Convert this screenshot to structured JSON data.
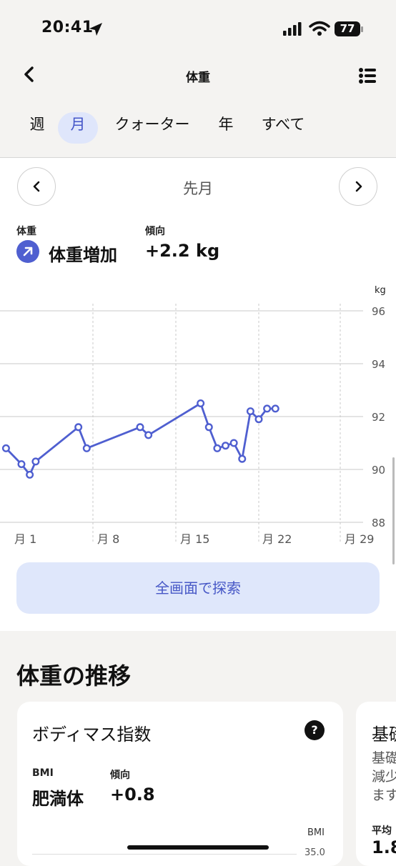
{
  "status_bar": {
    "time": "20:41",
    "battery": "77"
  },
  "header": {
    "title": "体重"
  },
  "period_tabs": [
    {
      "label": "週",
      "active": false
    },
    {
      "label": "月",
      "active": true
    },
    {
      "label": "クォーター",
      "active": false
    },
    {
      "label": "年",
      "active": false
    },
    {
      "label": "すべて",
      "active": false
    }
  ],
  "range": {
    "label": "先月"
  },
  "summary": {
    "weight_label": "体重",
    "weight_value": "体重増加",
    "trend_label": "傾向",
    "trend_value": "+2.2 kg"
  },
  "chart_data": {
    "type": "line",
    "unit": "kg",
    "ylim": [
      88,
      96
    ],
    "y_ticks": [
      "96",
      "94",
      "92",
      "90",
      "88"
    ],
    "x_ticks": [
      "月 1",
      "月 8",
      "月 15",
      "月 22",
      "月 29"
    ],
    "grid": true,
    "color": "#4f5fd0",
    "series": [
      {
        "day": [
          -1.3,
          0,
          0.7,
          1.2,
          4.8,
          5.5,
          10.0,
          10.7,
          15.1,
          15.8,
          16.5,
          17.2,
          17.9,
          18.6,
          19.3,
          20.0,
          20.7,
          21.4
        ],
        "values": [
          90.8,
          90.2,
          89.8,
          90.3,
          91.6,
          90.8,
          91.6,
          91.3,
          92.5,
          91.6,
          90.8,
          90.9,
          91.0,
          90.4,
          92.2,
          91.9,
          92.3,
          92.3
        ]
      }
    ]
  },
  "explore_button": {
    "label": "全画面で探索"
  },
  "section": {
    "title": "体重の推移"
  },
  "bmi_card": {
    "title": "ボディマス指数",
    "help": "?",
    "bmi_label": "BMI",
    "bmi_value": "肥満体",
    "trend_label": "傾向",
    "trend_value": "+0.8",
    "axis_unit": "BMI",
    "axis_top": "35.0"
  },
  "next_card": {
    "title": "基礎",
    "lines": [
      "基礎",
      "減少",
      "ます"
    ],
    "avg_label": "平均",
    "avg_value": "1.8"
  }
}
